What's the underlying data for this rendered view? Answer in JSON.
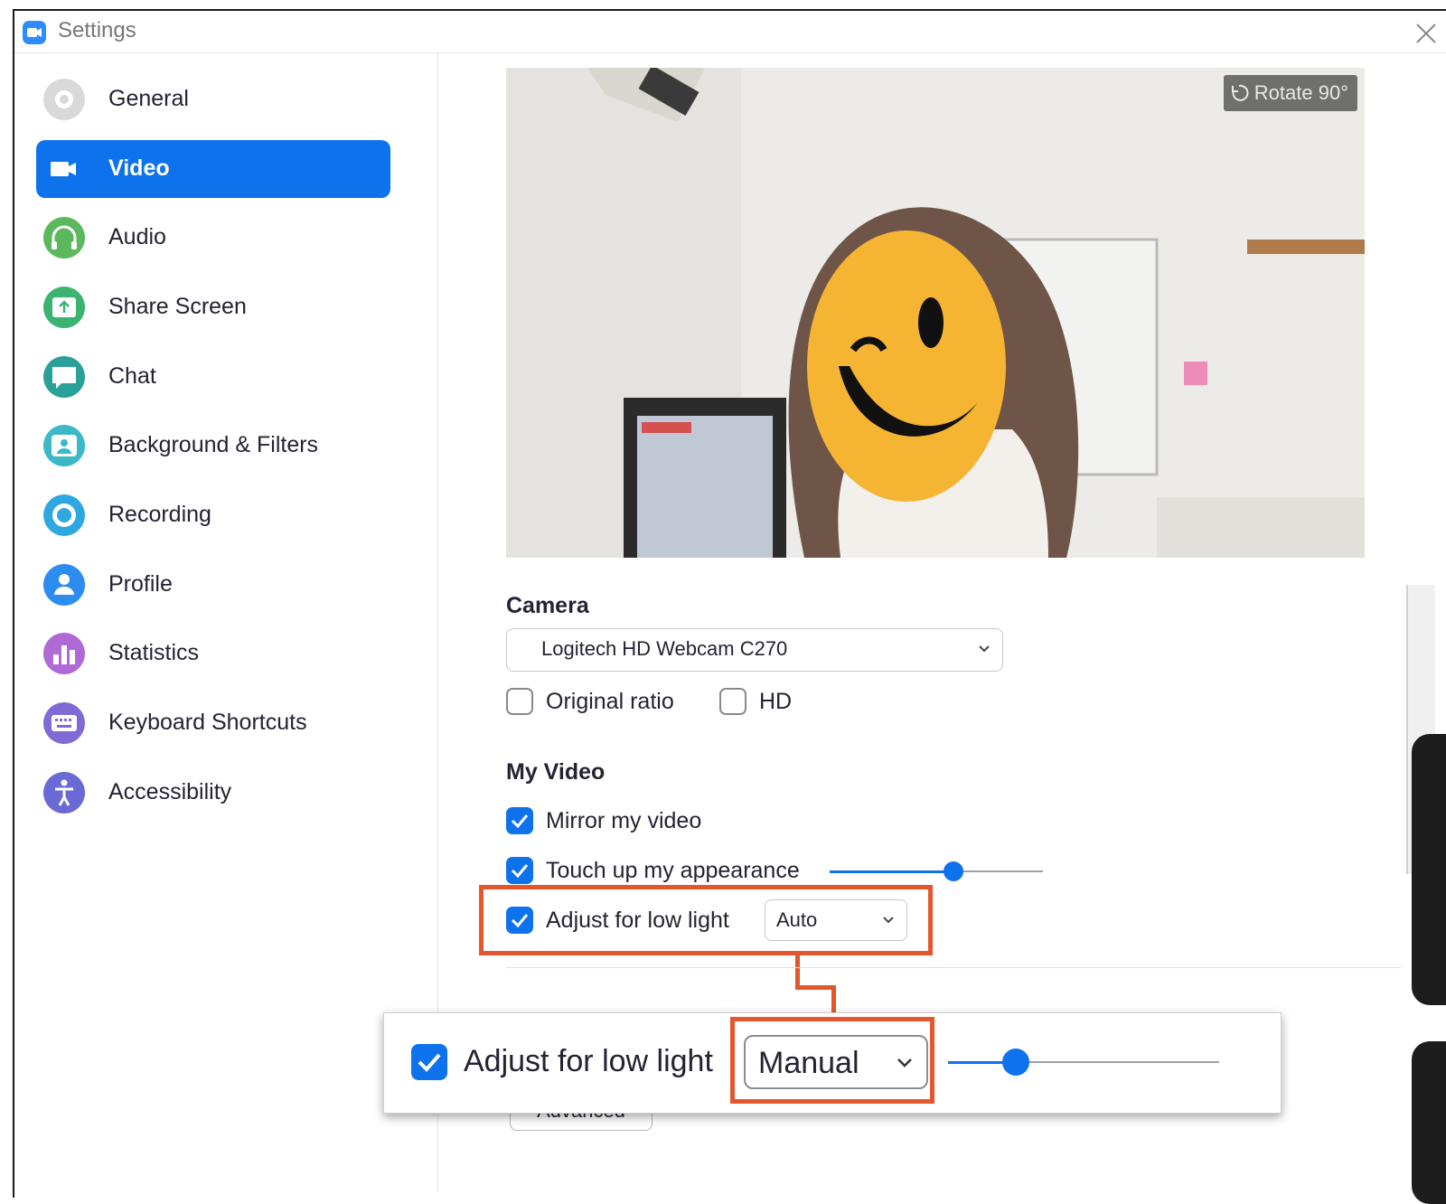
{
  "window": {
    "title": "Settings"
  },
  "sidebar": {
    "items": [
      {
        "label": "General",
        "icon": "gear-icon",
        "color": "#d9d9d9",
        "active": false
      },
      {
        "label": "Video",
        "icon": "video-camera-icon",
        "color": "#0e72ed",
        "active": true
      },
      {
        "label": "Audio",
        "icon": "headphones-icon",
        "color": "#5cb85c",
        "active": false
      },
      {
        "label": "Share Screen",
        "icon": "share-screen-icon",
        "color": "#3cb371",
        "active": false
      },
      {
        "label": "Chat",
        "icon": "chat-bubble-icon",
        "color": "#2aa198",
        "active": false
      },
      {
        "label": "Background & Filters",
        "icon": "background-person-icon",
        "color": "#3bb9c9",
        "active": false
      },
      {
        "label": "Recording",
        "icon": "record-icon",
        "color": "#2da8e0",
        "active": false
      },
      {
        "label": "Profile",
        "icon": "profile-person-icon",
        "color": "#2d8cf0",
        "active": false
      },
      {
        "label": "Statistics",
        "icon": "bar-chart-icon",
        "color": "#b06ad6",
        "active": false
      },
      {
        "label": "Keyboard Shortcuts",
        "icon": "keyboard-icon",
        "color": "#7f6ad6",
        "active": false
      },
      {
        "label": "Accessibility",
        "icon": "accessibility-person-icon",
        "color": "#6a6ad6",
        "active": false
      }
    ]
  },
  "preview": {
    "rotate_label": "Rotate 90°"
  },
  "camera": {
    "heading": "Camera",
    "selected": "Logitech HD Webcam C270",
    "original_ratio_label": "Original ratio",
    "original_ratio_checked": false,
    "hd_label": "HD",
    "hd_checked": false
  },
  "my_video": {
    "heading": "My Video",
    "mirror_label": "Mirror my video",
    "mirror_checked": true,
    "touch_up_label": "Touch up my appearance",
    "touch_up_checked": true,
    "touch_up_level": 0.58,
    "low_light_label": "Adjust for low light",
    "low_light_checked": true,
    "low_light_mode": "Auto"
  },
  "advanced_label": "Advanced",
  "callout": {
    "label": "Adjust for low light",
    "checked": true,
    "mode": "Manual",
    "level": 0.25
  },
  "colors": {
    "accent": "#0e72ed",
    "highlight": "#e4572e"
  }
}
